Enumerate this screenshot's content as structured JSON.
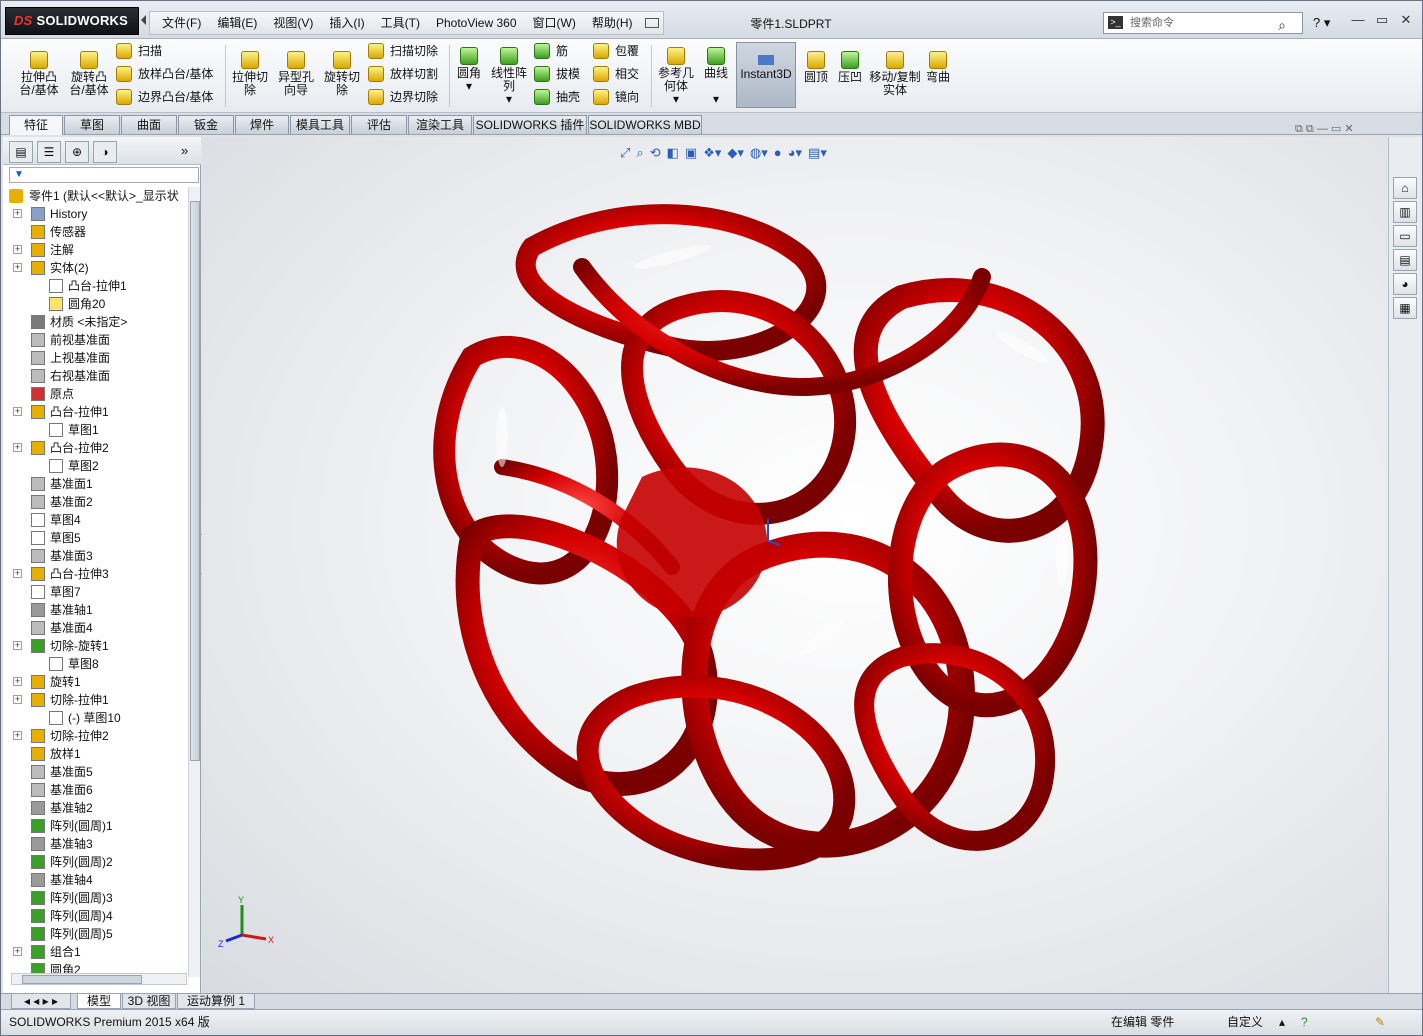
{
  "app": {
    "logo": "SOLIDWORKS",
    "doc_title": "零件1.SLDPRT",
    "search_placeholder": "搜索命令"
  },
  "menu": [
    "文件(F)",
    "编辑(E)",
    "视图(V)",
    "插入(I)",
    "工具(T)",
    "PhotoView 360",
    "窗口(W)",
    "帮助(H)"
  ],
  "ribbon": {
    "extrude_boss": "拉伸凸台/基体",
    "revolve_boss": "旋转凸台/基体",
    "sweep": "扫描",
    "loft_boss": "放样凸台/基体",
    "boundary_boss": "边界凸台/基体",
    "extrude_cut": "拉伸切除",
    "hole_wizard": "异型孔向导",
    "revolve_cut": "旋转切除",
    "sweep_cut": "扫描切除",
    "loft_cut": "放样切割",
    "boundary_cut": "边界切除",
    "fillet": "圆角",
    "linear_pattern": "线性阵列",
    "rib": "筋",
    "draft": "拔模",
    "shell": "抽壳",
    "wrap": "包覆",
    "intersect": "相交",
    "mirror": "镜向",
    "ref_geometry": "参考几何体",
    "curves": "曲线",
    "instant3d": "Instant3D",
    "dome": "圆顶",
    "indent": "压凹",
    "move_copy": "移动/复制实体",
    "flex": "弯曲"
  },
  "tabs": [
    "特征",
    "草图",
    "曲面",
    "钣金",
    "焊件",
    "模具工具",
    "评估",
    "渲染工具",
    "SOLIDWORKS 插件",
    "SOLIDWORKS MBD"
  ],
  "tree": {
    "root": "零件1 (默认<<默认>_显示状",
    "items": [
      "History",
      "传感器",
      "注解",
      "实体(2)",
      "凸台-拉伸1",
      "圆角20",
      "材质 <未指定>",
      "前视基准面",
      "上视基准面",
      "右视基准面",
      "原点",
      "凸台-拉伸1",
      "草图1",
      "凸台-拉伸2",
      "草图2",
      "基准面1",
      "基准面2",
      "草图4",
      "草图5",
      "基准面3",
      "凸台-拉伸3",
      "草图7",
      "基准轴1",
      "基准面4",
      "切除-旋转1",
      "草图8",
      "旋转1",
      "切除-拉伸1",
      "(-) 草图10",
      "切除-拉伸2",
      "放样1",
      "基准面5",
      "基准面6",
      "基准轴2",
      "阵列(圆周)1",
      "基准轴3",
      "阵列(圆周)2",
      "基准轴4",
      "阵列(圆周)3",
      "阵列(圆周)4",
      "阵列(圆周)5",
      "组合1",
      "圆角2"
    ]
  },
  "model_color": "#e00000",
  "bottom_tabs": [
    "模型",
    "3D 视图",
    "运动算例 1"
  ],
  "status": {
    "product": "SOLIDWORKS Premium 2015 x64 版",
    "editing": "在编辑 零件",
    "custom": "自定义"
  }
}
